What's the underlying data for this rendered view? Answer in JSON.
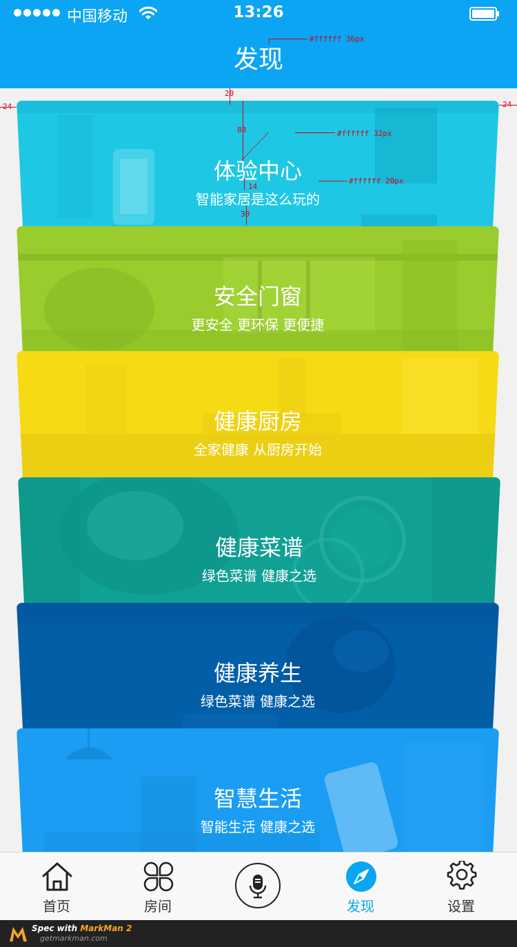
{
  "status_bar": {
    "carrier": "中国移动",
    "time": "13:26"
  },
  "nav": {
    "title": "发现"
  },
  "cards": [
    {
      "title": "体验中心",
      "subtitle": "智能家居是这么玩的",
      "color": "#1ec8e4"
    },
    {
      "title": "安全门窗",
      "subtitle": "更安全  更环保  更便捷",
      "color": "#99cc2c"
    },
    {
      "title": "健康厨房",
      "subtitle": "全家健康  从厨房开始",
      "color": "#f6da14"
    },
    {
      "title": "健康菜谱",
      "subtitle": "绿色菜谱  健康之选",
      "color": "#10a094"
    },
    {
      "title": "健康养生",
      "subtitle": "绿色菜谱  健康之选",
      "color": "#035ea8"
    },
    {
      "title": "智慧生活",
      "subtitle": "智能生活  健康之选",
      "color": "#1a9df2"
    }
  ],
  "spec_annotations": {
    "nav_title": "#ffffff  36px",
    "card_title": "#ffffff 32px",
    "card_subtitle": "#ffffff  20px",
    "gap_top": "20",
    "title_top": "88",
    "title_sub_gap": "14",
    "sub_bottom": "30",
    "side_left": "24",
    "side_right": "24"
  },
  "tabs": [
    {
      "label": "首页",
      "icon": "home-icon",
      "active": false
    },
    {
      "label": "房间",
      "icon": "rooms-icon",
      "active": false
    },
    {
      "label": "",
      "icon": "microphone-icon",
      "active": false
    },
    {
      "label": "发现",
      "icon": "compass-icon",
      "active": true
    },
    {
      "label": "设置",
      "icon": "gear-icon",
      "active": false
    }
  ],
  "footer": {
    "spec_with": "Spec with",
    "brand": "MarkMan 2",
    "site": "getmarkman.com"
  },
  "colors": {
    "primary": "#0ba5f3",
    "tab_active": "#0ba5f3",
    "tab_inactive": "#333333"
  }
}
